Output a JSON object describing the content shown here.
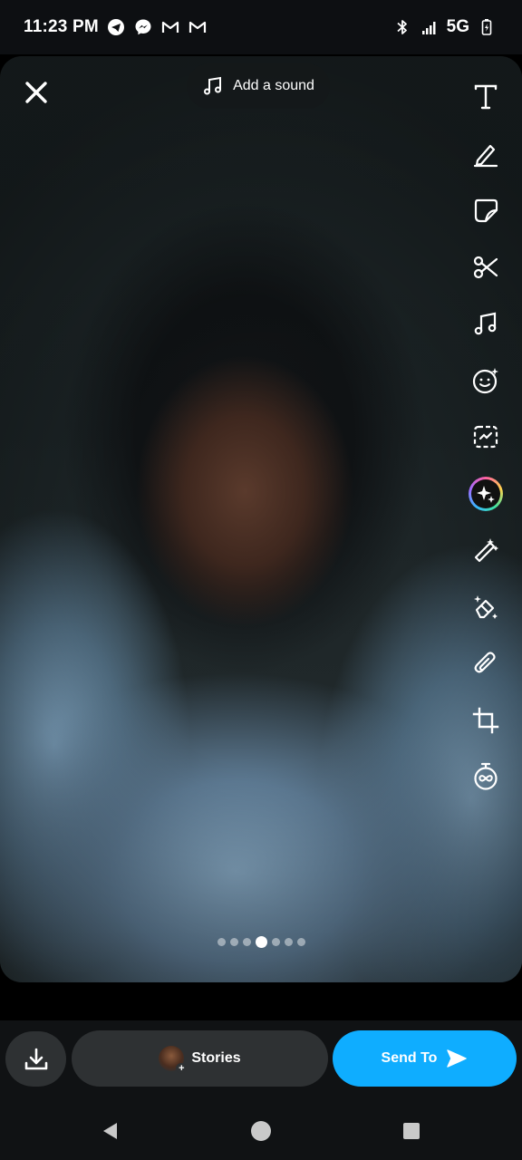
{
  "status_bar": {
    "time": "11:23 PM",
    "left_icons": [
      "telegram-icon",
      "messenger-icon",
      "gmail-icon",
      "gmail-icon"
    ],
    "right_icons": [
      "bluetooth-icon",
      "signal-icon",
      "battery-charging-icon"
    ],
    "network": "5G"
  },
  "editor": {
    "close_icon": "close-icon",
    "sound_button": {
      "icon": "music-note-icon",
      "label": "Add a sound"
    },
    "tools": [
      "text-icon",
      "pencil-icon",
      "sticker-icon",
      "scissors-icon",
      "music-icon",
      "lens-icon",
      "scan-icon",
      "ai-sparkle-icon",
      "magic-wand-icon",
      "magic-eraser-icon",
      "paperclip-icon",
      "crop-icon",
      "timer-infinity-icon"
    ],
    "page_indicator": {
      "count": 7,
      "active_index": 3
    }
  },
  "actions": {
    "save_icon": "download-icon",
    "stories_label": "Stories",
    "send_label": "Send To",
    "send_color": "#0fadff"
  },
  "nav": {
    "buttons": [
      "back-icon",
      "home-icon",
      "recents-icon"
    ]
  }
}
